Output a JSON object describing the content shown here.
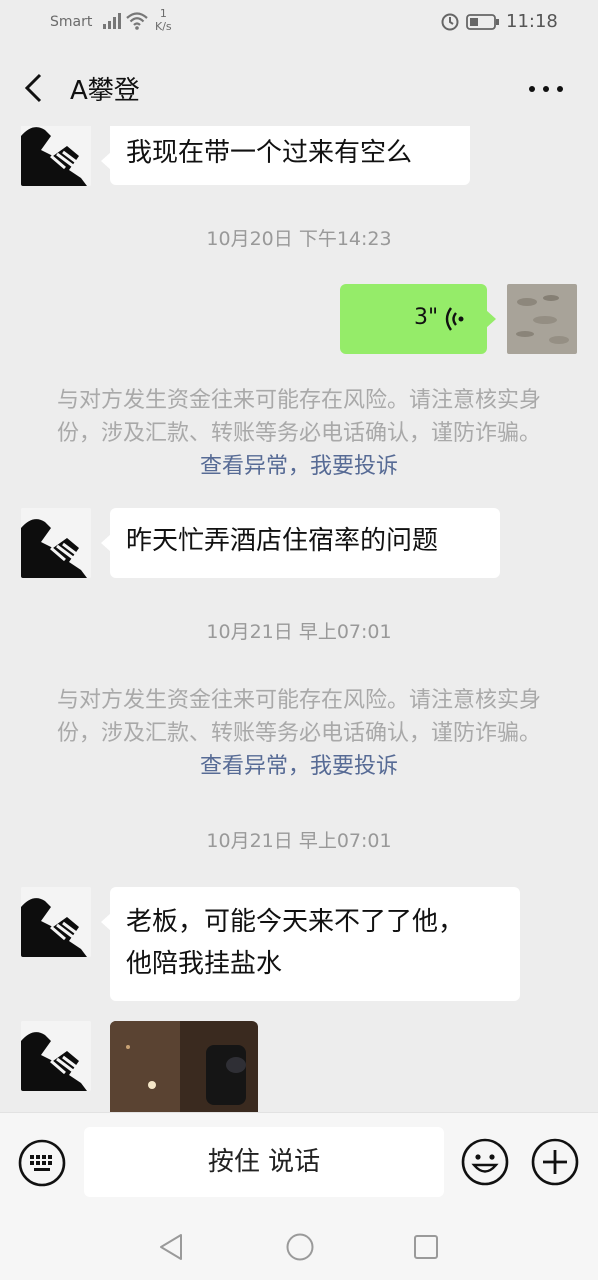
{
  "status_bar": {
    "carrier": "Smart",
    "net_speed_value": "1",
    "net_speed_unit": "K/s",
    "time": "11:18"
  },
  "header": {
    "back_icon": "chevron-left-icon",
    "title": "A攀登",
    "more_icon": "more-dots-icon"
  },
  "messages": {
    "m1": {
      "side": "left",
      "text": "我现在带一个过来有空么"
    },
    "ts1": "10月20日 下午14:23",
    "voice": {
      "side": "right",
      "duration": "3\""
    },
    "notice1": {
      "text": "与对方发生资金往来可能存在风险。请注意核实身份，涉及汇款、转账等务必电话确认，谨防诈骗。",
      "link_view": "查看异常",
      "sep": "，",
      "link_report": "我要投诉"
    },
    "m2": {
      "side": "left",
      "text": "昨天忙弄酒店住宿率的问题"
    },
    "ts2": "10月21日 早上07:01",
    "notice2": {
      "text": "与对方发生资金往来可能存在风险。请注意核实身份，涉及汇款、转账等务必电话确认，谨防诈骗。",
      "link_view": "查看异常",
      "sep": "，",
      "link_report": "我要投诉"
    },
    "ts3": "10月21日 早上07:01",
    "m3": {
      "side": "left",
      "line1": "老板，可能今天来不了了他，",
      "line2": "他陪我挂盐水"
    }
  },
  "input_bar": {
    "keyboard_icon": "keyboard-icon",
    "hold_to_talk": "按住 说话",
    "emoji_icon": "emoji-icon",
    "plus_icon": "plus-icon"
  },
  "colors": {
    "background": "#ededed",
    "sent_bubble": "#95ec69",
    "link": "#576b95"
  }
}
